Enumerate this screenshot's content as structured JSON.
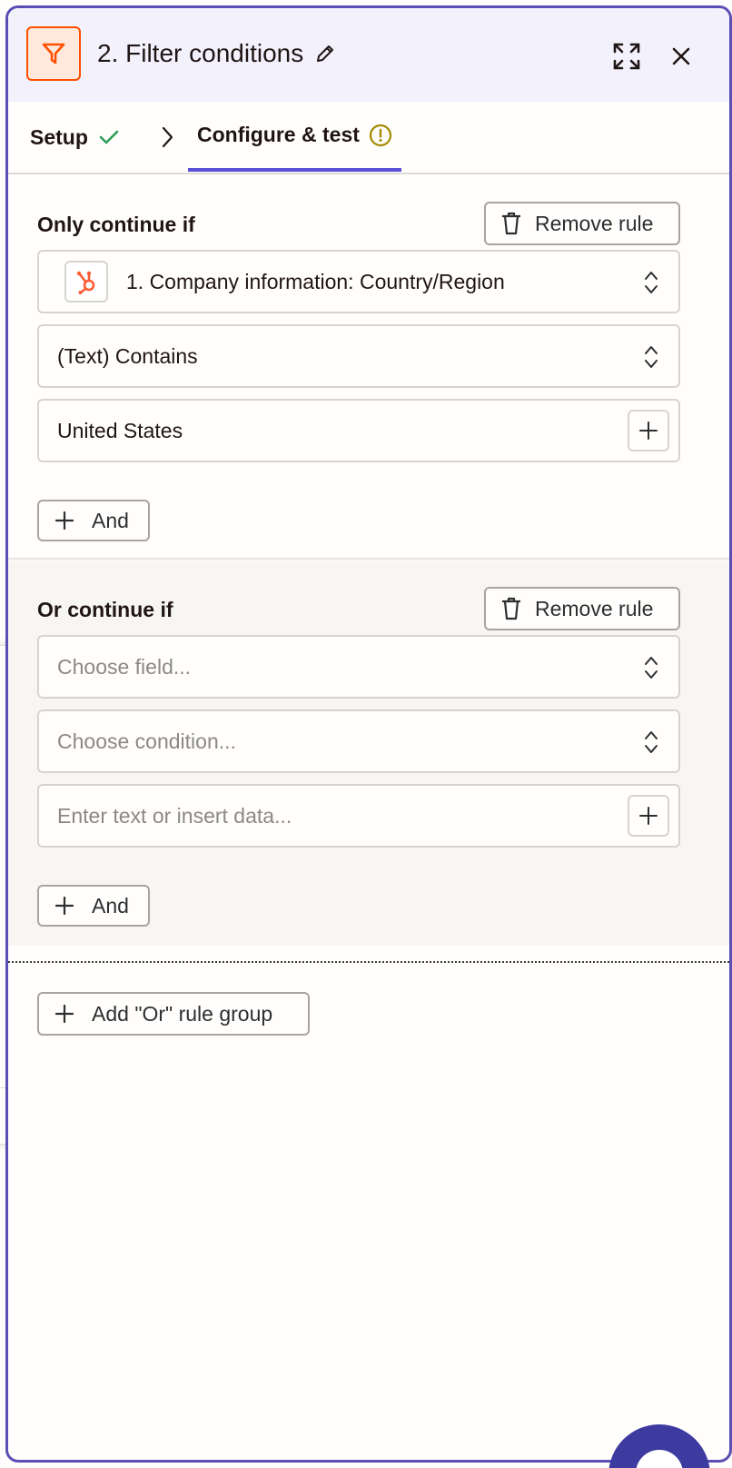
{
  "header": {
    "title": "2. Filter conditions",
    "app_icon": "filter-icon",
    "edit_icon": "pencil-icon",
    "expand_icon": "expand-icon",
    "close_icon": "close-icon"
  },
  "tabs": [
    {
      "label": "Setup",
      "status": "complete",
      "status_icon": "check-icon"
    },
    {
      "label": "Configure & test",
      "status": "warning",
      "status_icon": "warning-icon",
      "active": true
    }
  ],
  "rule_groups": [
    {
      "label": "Only continue if",
      "remove_label": "Remove rule",
      "field": {
        "value": "1. Company information: Country/Region",
        "app_icon": "hubspot-icon"
      },
      "condition": {
        "value": "(Text) Contains"
      },
      "value_input": {
        "value": "United States"
      },
      "and_label": "And"
    },
    {
      "label": "Or continue if",
      "remove_label": "Remove rule",
      "field": {
        "placeholder": "Choose field..."
      },
      "condition": {
        "placeholder": "Choose condition..."
      },
      "value_input": {
        "placeholder": "Enter text or insert data..."
      },
      "and_label": "And"
    }
  ],
  "add_or_group_label": "Add \"Or\" rule group",
  "colors": {
    "accent": "#5a4fd8",
    "brand_orange": "#ff4f00",
    "success": "#2e9e5b",
    "warning": "#a38a00"
  }
}
